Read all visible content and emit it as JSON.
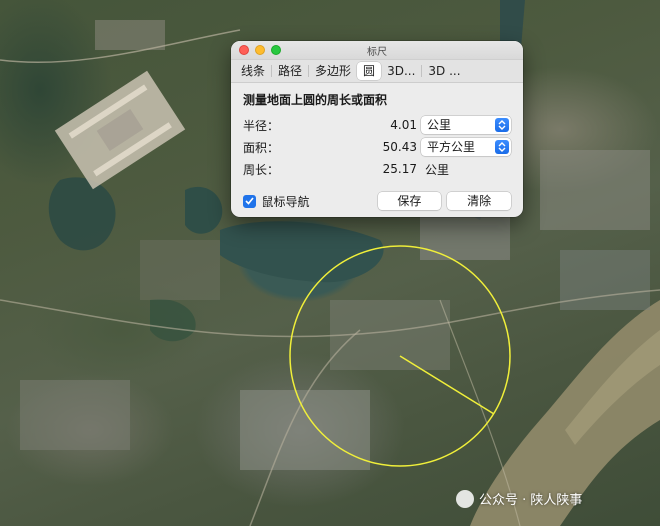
{
  "window": {
    "title": "标尺",
    "tabs": [
      "线条",
      "路径",
      "多边形",
      "圆",
      "3D...",
      "3D ..."
    ],
    "active_tab": "圆",
    "heading": "测量地面上圆的周长或面积",
    "radius": {
      "label": "半径：",
      "value": "4.01",
      "unit": "公里"
    },
    "area": {
      "label": "面积：",
      "value": "50.43",
      "unit": "平方公里"
    },
    "circumference": {
      "label": "周长：",
      "value": "25.17",
      "unit": "公里"
    },
    "mouse_nav_label": "鼠标导航",
    "mouse_nav_checked": true,
    "save_label": "保存",
    "clear_label": "清除"
  },
  "watermark": {
    "text": "公众号 · 陕人陕事"
  },
  "colors": {
    "circle": "#f0ef3a",
    "accent": "#1f73ea"
  }
}
